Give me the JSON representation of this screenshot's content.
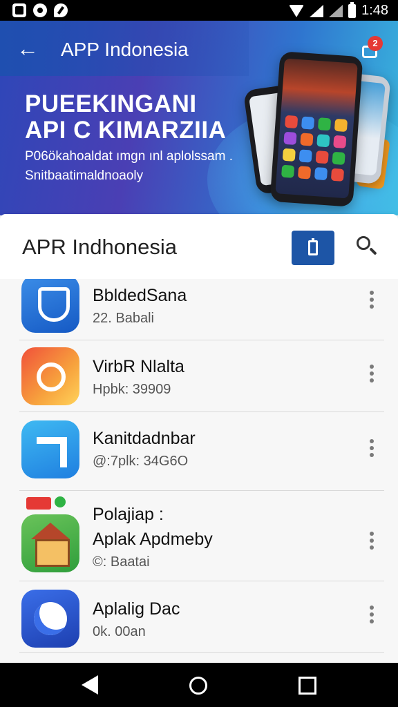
{
  "status_bar": {
    "time": "1:48"
  },
  "header": {
    "title": "APP Indonesia",
    "notification_count": "2"
  },
  "banner": {
    "headline_line1": "PUEEKINGANI",
    "headline_line2": "API C KIMARZIIA",
    "subtext_line1": "P06ökahoaldat ımgn ınl aplolssam .",
    "subtext_line2": "Snitbaatimaldnoaoly"
  },
  "search": {
    "title": "APR Indhonesia"
  },
  "apps": [
    {
      "name": "BbldedSana",
      "meta": "22. Babali",
      "icon": "shield-app-icon"
    },
    {
      "name": "VirbR Nlalta",
      "meta": "Hpbk: 39909",
      "icon": "camera-app-icon"
    },
    {
      "name": "Kanitdadnbar",
      "meta": "@:7plk: 34G6O",
      "icon": "arrow-app-icon"
    },
    {
      "name_line1": "Polajiap :",
      "name_line2": "Aplak Apdmeby",
      "meta": "©: Baatai",
      "icon": "house-app-icon"
    },
    {
      "name": "Aplalig Dac",
      "meta": "0k. 00an",
      "icon": "phone-app-icon"
    }
  ],
  "colors": {
    "banner_start": "#2e47b8",
    "banner_end": "#3ab8de",
    "accent": "#1d55a6",
    "badge": "#e53935"
  }
}
